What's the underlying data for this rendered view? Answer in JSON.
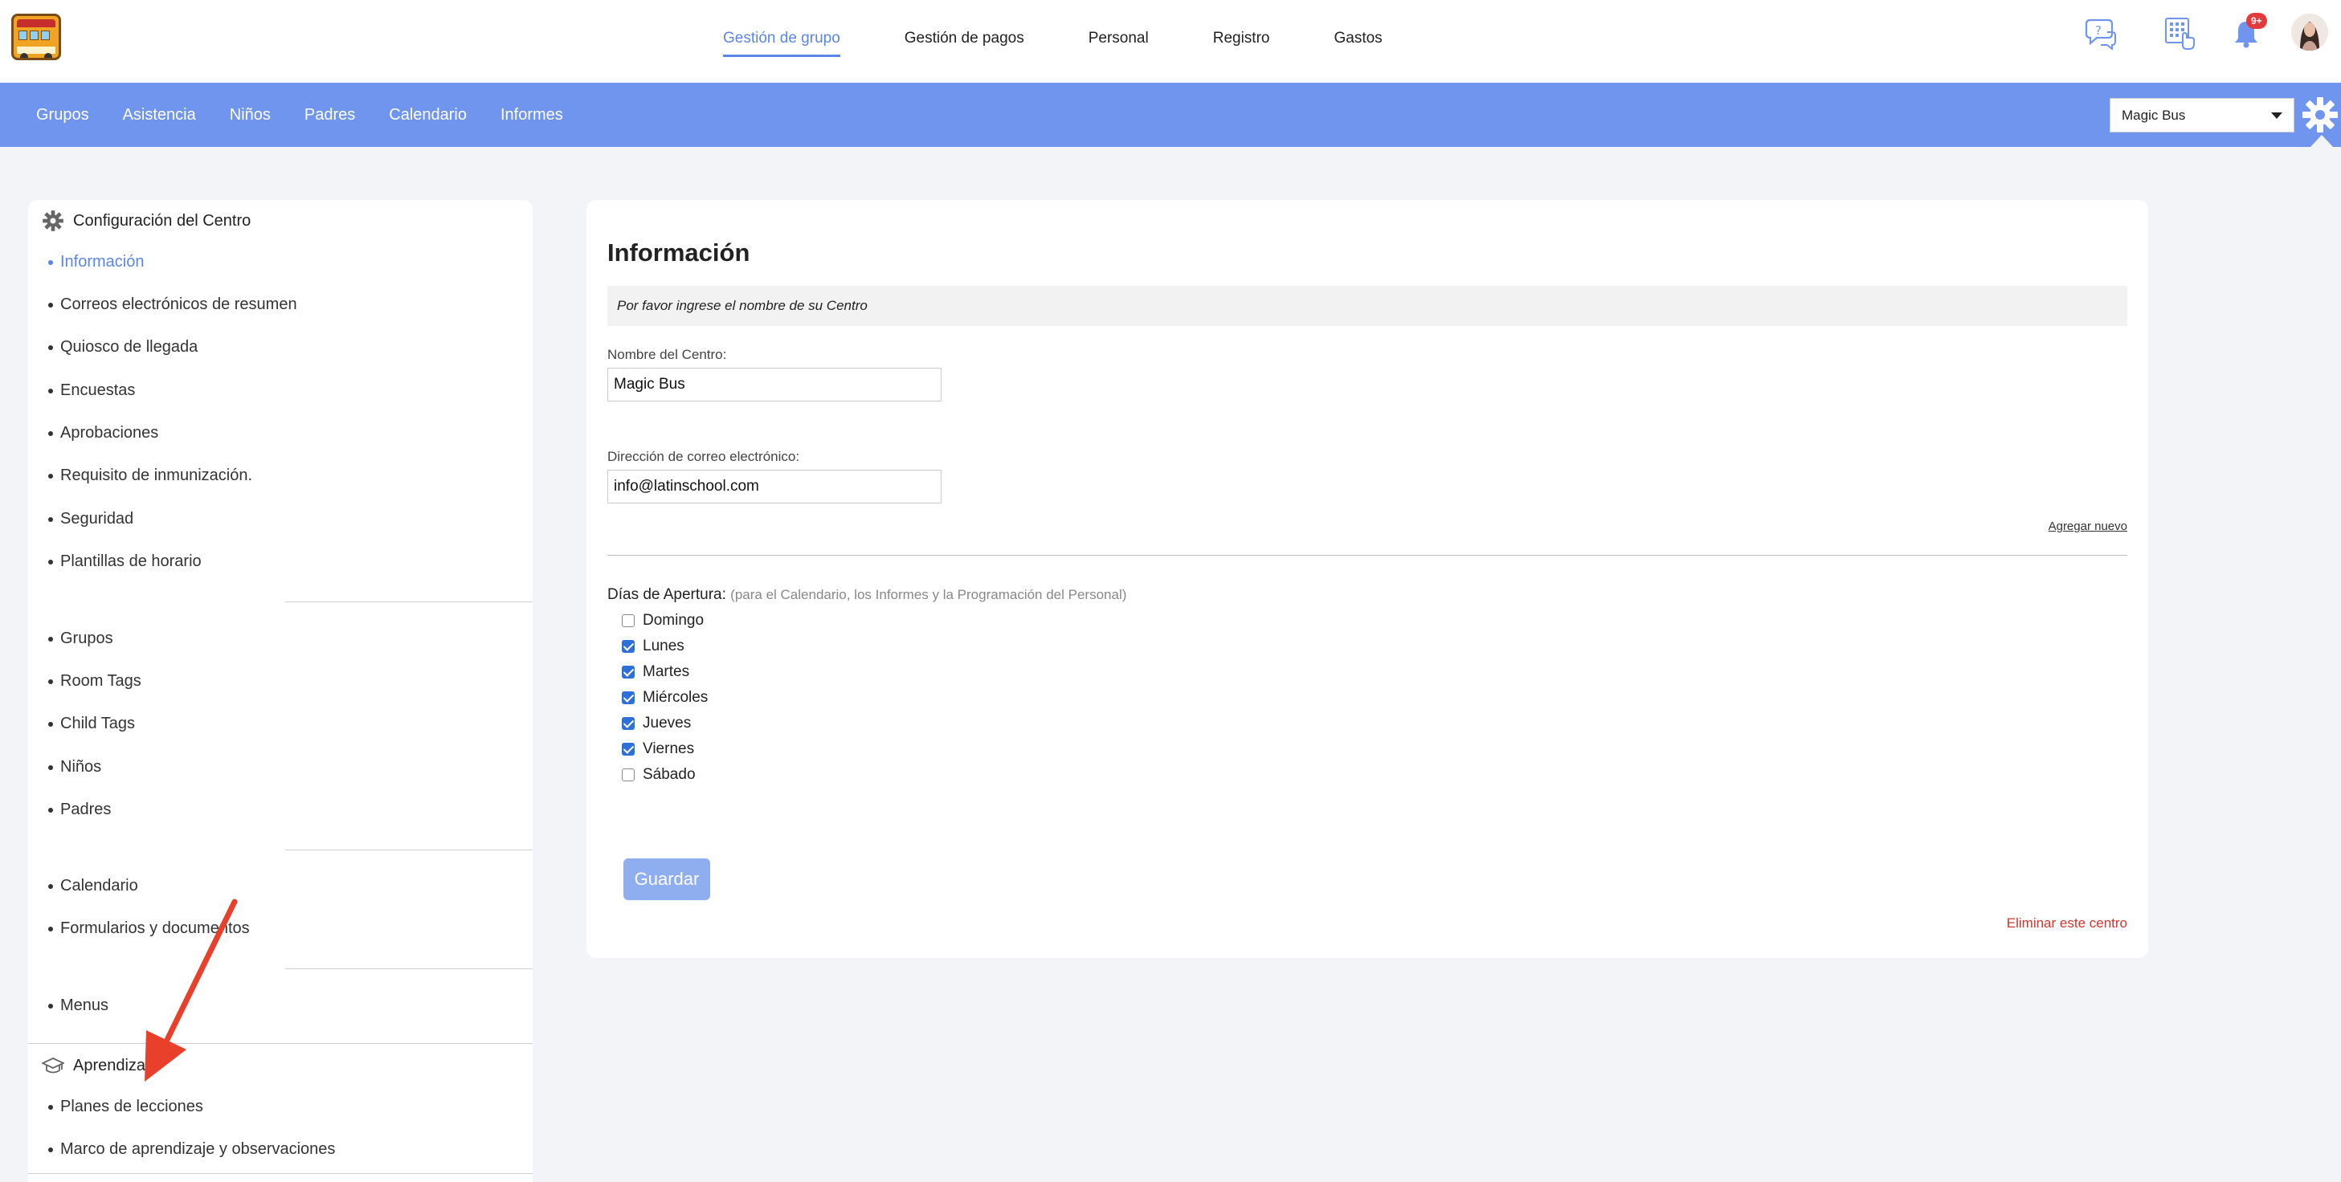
{
  "topnav": {
    "items": [
      "Gestión de grupo",
      "Gestión de pagos",
      "Personal",
      "Registro",
      "Gastos"
    ],
    "notif_badge": "9+"
  },
  "subnav": {
    "items": [
      "Grupos",
      "Asistencia",
      "Niños",
      "Padres",
      "Calendario",
      "Informes"
    ],
    "center_select": "Magic Bus"
  },
  "sidebar": {
    "config_title": "Configuración del Centro",
    "group1": [
      "Información",
      "Correos electrónicos de resumen",
      "Quiosco de llegada",
      "Encuestas",
      "Aprobaciones",
      "Requisito de inmunización.",
      "Seguridad",
      "Plantillas de horario"
    ],
    "group2": [
      "Grupos",
      "Room Tags",
      "Child Tags",
      "Niños",
      "Padres"
    ],
    "group3": [
      "Calendario",
      "Formularios y documentos"
    ],
    "group4": [
      "Menus"
    ],
    "learning_title": "Aprendizaje",
    "learning_items": [
      "Planes de lecciones",
      "Marco de aprendizaje y observaciones"
    ]
  },
  "main": {
    "title": "Información",
    "notice": "Por favor ingrese el nombre de su Centro",
    "name_label": "Nombre del Centro:",
    "name_value": "Magic Bus",
    "email_label": "Dirección de correo electrónico:",
    "email_value": "info@latinschool.com",
    "add_new": "Agregar nuevo",
    "days_label": "Días de Apertura:",
    "days_hint": "(para el Calendario, los Informes y la Programación del Personal)",
    "days": [
      {
        "label": "Domingo",
        "checked": false
      },
      {
        "label": "Lunes",
        "checked": true
      },
      {
        "label": "Martes",
        "checked": true
      },
      {
        "label": "Miércoles",
        "checked": true
      },
      {
        "label": "Jueves",
        "checked": true
      },
      {
        "label": "Viernes",
        "checked": true
      },
      {
        "label": "Sábado",
        "checked": false
      }
    ],
    "save_label": "Guardar",
    "delete_label": "Eliminar este centro"
  },
  "colors": {
    "accent": "#5b86e5",
    "nav_bar": "#6f95ee",
    "save_button": "#8eaef0",
    "delete_link": "#d0342c",
    "annotation_arrow": "#e8402a"
  },
  "icons": [
    "help-chat-icon",
    "kiosk-tap-icon",
    "bell-icon",
    "gear-icon",
    "mortarboard-icon"
  ]
}
